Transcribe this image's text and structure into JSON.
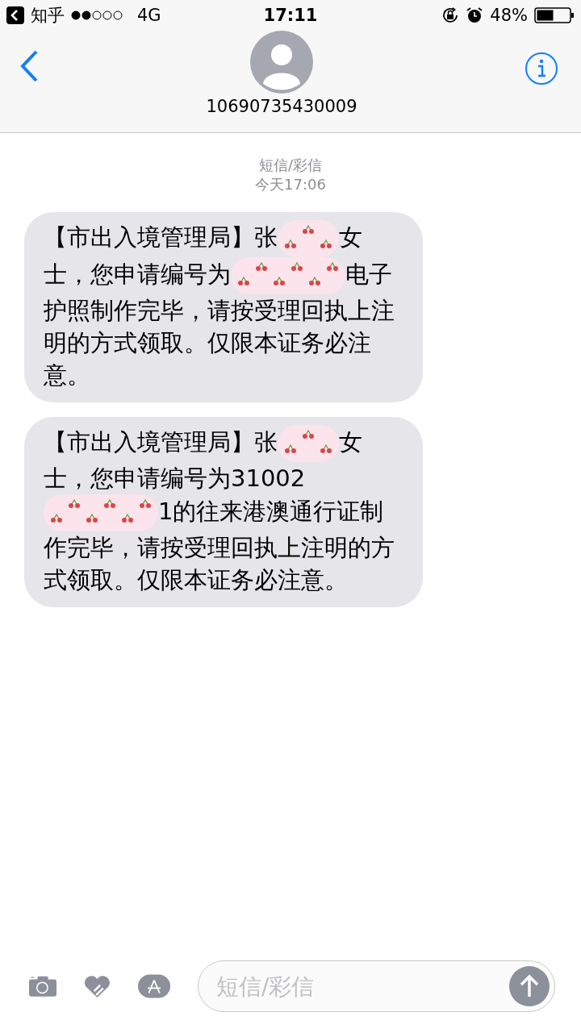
{
  "status_bar": {
    "back_app": "知乎",
    "network": "4G",
    "time": "17:11",
    "battery": "48%"
  },
  "header": {
    "contact": "10690735430009"
  },
  "thread": {
    "service": "短信/彩信",
    "timestamp": "今天17:06"
  },
  "messages": [
    {
      "segments": [
        {
          "kind": "text",
          "text": "【市出入境管理局】张"
        },
        {
          "kind": "redaction"
        },
        {
          "kind": "text",
          "text": "女士，您申请编号为"
        },
        {
          "kind": "redaction"
        },
        {
          "kind": "text",
          "text": "电子护照制作完毕，请按受理回执上注明的方式领取。仅限本证务必注意。"
        }
      ]
    },
    {
      "segments": [
        {
          "kind": "text",
          "text": "【市出入境管理局】张"
        },
        {
          "kind": "redaction"
        },
        {
          "kind": "text",
          "text": "女士，您申请编号为31002"
        },
        {
          "kind": "redaction"
        },
        {
          "kind": "text",
          "text": "1的往来港澳通行证制作完毕，请按受理回执上注明的方式领取。仅限本证务必注意。"
        }
      ]
    }
  ],
  "composer": {
    "placeholder": "短信/彩信"
  }
}
